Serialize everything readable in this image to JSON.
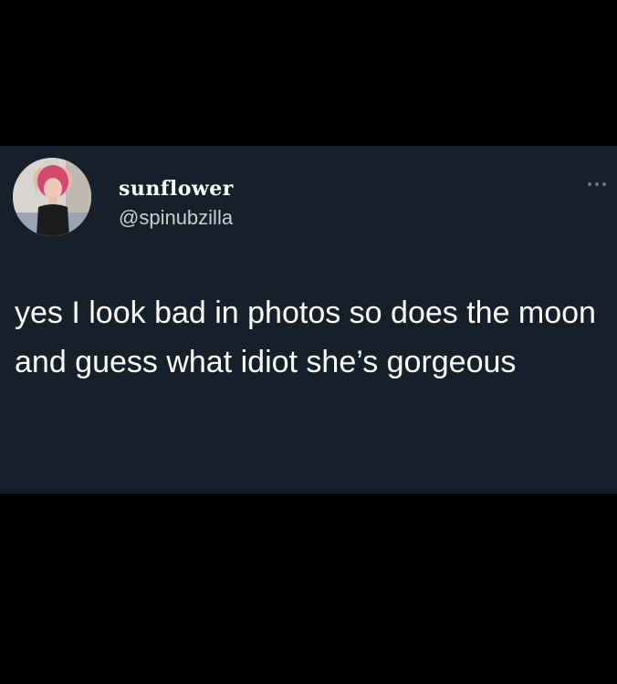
{
  "tweet": {
    "display_name": "sunflower",
    "handle": "@spinubzilla",
    "text": "yes I look bad in photos so does the moon and guess what idiot she’s gorgeous",
    "more_icon": "more-horizontal-icon"
  },
  "colors": {
    "page_background": "#000000",
    "card_background": "#15202b",
    "primary_text": "#ffffff",
    "secondary_text": "#c9ced3",
    "icon_muted": "#6e767d"
  }
}
